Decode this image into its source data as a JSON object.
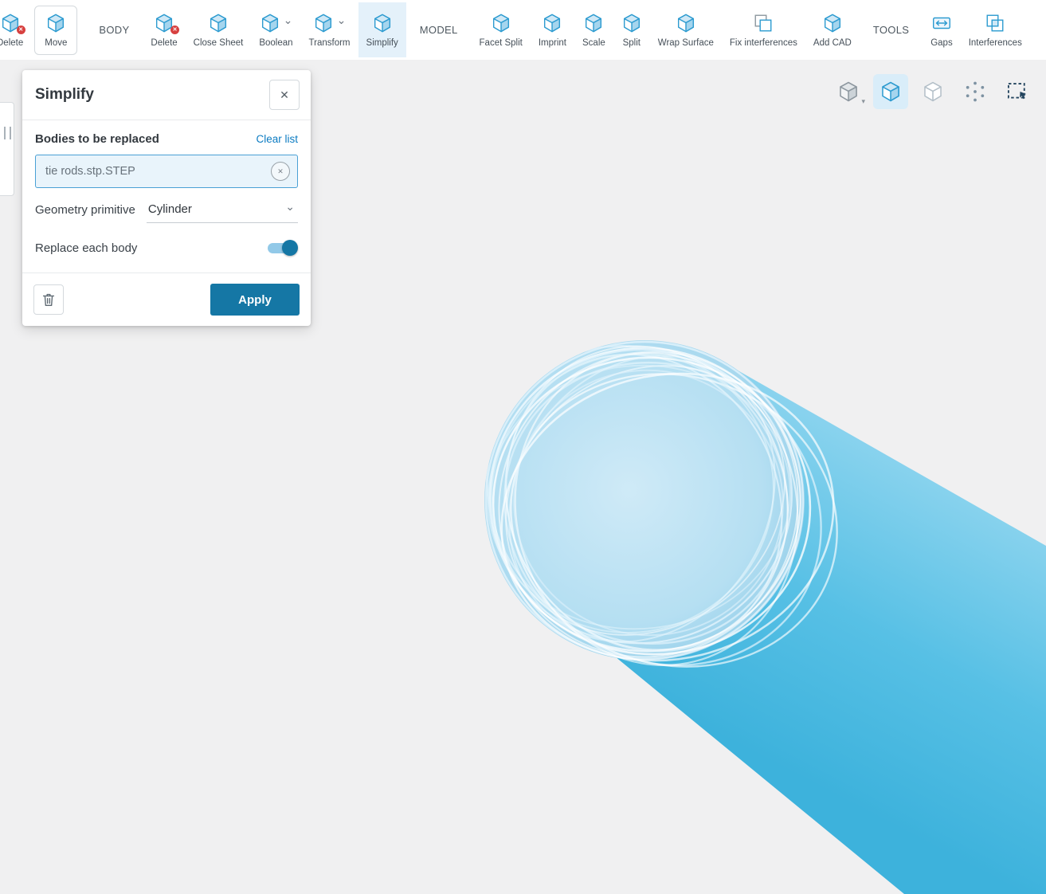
{
  "colors": {
    "accent": "#1577a5",
    "link": "#0b7bc2",
    "icon_blue": "#2d9bd0",
    "toolbar_active_bg": "#e4f1fa",
    "canvas_bg": "#f0f0f1",
    "cylinder_light": "#9fd9f0",
    "cylinder_mid": "#57c0e5",
    "cylinder_dark": "#3db2dc",
    "cap_fill": "#bde2f4",
    "wireframe": "#eaf7fd",
    "delete_badge": "#d7403f"
  },
  "glyphs": {
    "x": "✕",
    "chevron": "⌄",
    "caret": "▾"
  },
  "toolbar": {
    "items": [
      {
        "label": "Delete"
      },
      {
        "label": "Move"
      },
      {
        "label": "BODY"
      },
      {
        "label": "Delete"
      },
      {
        "label": "Close Sheet"
      },
      {
        "label": "Boolean"
      },
      {
        "label": "Transform"
      },
      {
        "label": "Simplify"
      },
      {
        "label": "MODEL"
      },
      {
        "label": "Facet Split"
      },
      {
        "label": "Imprint"
      },
      {
        "label": "Scale"
      },
      {
        "label": "Split"
      },
      {
        "label": "Wrap Surface"
      },
      {
        "label": "Fix interferences"
      },
      {
        "label": "Add CAD"
      },
      {
        "label": "TOOLS"
      },
      {
        "label": "Gaps"
      },
      {
        "label": "Interferences"
      }
    ]
  },
  "view_toolbar": {
    "icons": [
      "display-mode-cube",
      "shaded-view-cube",
      "wireframe-view-cube",
      "vertices-view",
      "box-select"
    ],
    "active": "shaded-view-cube"
  },
  "dialog": {
    "title": "Simplify",
    "bodies_section_label": "Bodies to be replaced",
    "clear_list_label": "Clear list",
    "selected_body_name": "tie rods.stp.STEP",
    "geometry_primitive_label": "Geometry primitive",
    "geometry_primitive_value": "Cylinder",
    "replace_each_body_label": "Replace each body",
    "replace_each_body_on": true,
    "apply_label": "Apply"
  }
}
